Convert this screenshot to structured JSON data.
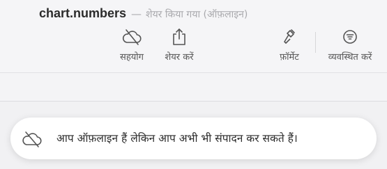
{
  "header": {
    "document_name": "chart.numbers",
    "separator": "—",
    "status": "शेयर किया गया (ऑफ़लाइन)"
  },
  "toolbar": {
    "collaborate": {
      "label": "सहयोग",
      "icon": "cloud-offline-icon"
    },
    "share": {
      "label": "शेयर करें",
      "icon": "share-icon"
    },
    "format": {
      "label": "फ़ॉर्मेट",
      "icon": "paintbrush-icon"
    },
    "organize": {
      "label": "व्यवस्थित करें",
      "icon": "filter-icon"
    }
  },
  "toast": {
    "message": "आप ऑफ़लाइन हैं लेकिन आप अभी भी संपादन कर सकते हैं।",
    "icon": "cloud-offline-icon"
  },
  "colors": {
    "icon": "#555555",
    "text": "#2b2b2b",
    "muted": "#a9a9ad",
    "background": "#f2f2f4"
  }
}
